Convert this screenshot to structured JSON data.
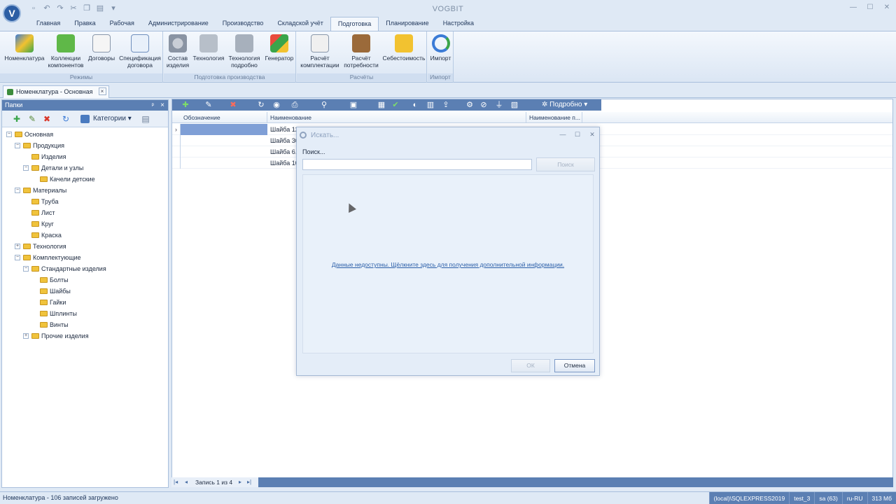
{
  "app": {
    "title": "VOGBIT",
    "logo_letter": "V"
  },
  "quick_access": [
    "new-icon",
    "undo-icon",
    "redo-icon",
    "cut-icon",
    "copy-icon",
    "paste-icon"
  ],
  "ribbon_tabs": [
    {
      "label": "Главная"
    },
    {
      "label": "Правка"
    },
    {
      "label": "Рабочая"
    },
    {
      "label": "Администрирование"
    },
    {
      "label": "Производство"
    },
    {
      "label": "Складской учёт"
    },
    {
      "label": "Подготовка",
      "active": true
    },
    {
      "label": "Планирование"
    },
    {
      "label": "Настройка"
    }
  ],
  "ribbon": {
    "groups": [
      {
        "caption": "Режимы",
        "buttons": [
          {
            "l1": "Номенклатура",
            "l2": "",
            "icon": "nomenclature-icon"
          },
          {
            "l1": "Коллекции",
            "l2": "компонентов",
            "icon": "collections-icon"
          },
          {
            "l1": "Договоры",
            "l2": "",
            "icon": "contracts-icon"
          },
          {
            "l1": "Спецификация",
            "l2": "договора",
            "icon": "contract-spec-icon"
          }
        ]
      },
      {
        "caption": "Подготовка производства",
        "buttons": [
          {
            "l1": "Состав",
            "l2": "изделия",
            "icon": "gear-icon"
          },
          {
            "l1": "Технология",
            "l2": "",
            "icon": "wrench-icon"
          },
          {
            "l1": "Технология",
            "l2": "подробно",
            "icon": "tools-icon"
          },
          {
            "l1": "Генератор",
            "l2": "",
            "icon": "shapes-icon"
          }
        ]
      },
      {
        "caption": "Расчёты",
        "buttons": [
          {
            "l1": "Расчёт",
            "l2": "комплектации",
            "icon": "calculator-icon"
          },
          {
            "l1": "Расчёт",
            "l2": "потребности",
            "icon": "abacus-icon"
          },
          {
            "l1": "Себестоимость",
            "l2": "",
            "icon": "coins-icon"
          }
        ]
      },
      {
        "caption": "Импорт",
        "buttons": [
          {
            "l1": "Импорт",
            "l2": "",
            "icon": "import-icon"
          }
        ]
      }
    ]
  },
  "doc_tab": {
    "label": "Номенклатура - Основная",
    "close": "×"
  },
  "left_panel": {
    "title": "Папки",
    "pin": "ᵖ",
    "close": "×",
    "categories_label": "Категории",
    "tree": [
      {
        "label": "Основная",
        "level": 0,
        "exp": "−"
      },
      {
        "label": "Продукция",
        "level": 1,
        "exp": "−"
      },
      {
        "label": "Изделия",
        "level": 2,
        "exp": ""
      },
      {
        "label": "Детали и узлы",
        "level": 2,
        "exp": "−"
      },
      {
        "label": "Качели детские",
        "level": 3,
        "exp": ""
      },
      {
        "label": "Материалы",
        "level": 1,
        "exp": "−"
      },
      {
        "label": "Труба",
        "level": 2,
        "exp": ""
      },
      {
        "label": "Лист",
        "level": 2,
        "exp": ""
      },
      {
        "label": "Круг",
        "level": 2,
        "exp": ""
      },
      {
        "label": "Краска",
        "level": 2,
        "exp": ""
      },
      {
        "label": "Технология",
        "level": 1,
        "exp": "+"
      },
      {
        "label": "Комплектующие",
        "level": 1,
        "exp": "−"
      },
      {
        "label": "Стандартные изделия",
        "level": 2,
        "exp": "−"
      },
      {
        "label": "Болты",
        "level": 3,
        "exp": ""
      },
      {
        "label": "Шайбы",
        "level": 3,
        "exp": ""
      },
      {
        "label": "Гайки",
        "level": 3,
        "exp": ""
      },
      {
        "label": "Шплинты",
        "level": 3,
        "exp": ""
      },
      {
        "label": "Винты",
        "level": 3,
        "exp": ""
      },
      {
        "label": "Прочие изделия",
        "level": 2,
        "exp": "+"
      }
    ]
  },
  "grid": {
    "detail_label": "Подробно",
    "columns": [
      "Обозначение",
      "Наименование",
      "Наименование п..."
    ],
    "rows": [
      {
        "oboz": "",
        "name": "Шайба 12",
        "selected": true
      },
      {
        "oboz": "",
        "name": "Шайба 30",
        "selected": false
      },
      {
        "oboz": "",
        "name": "Шайба 6.0",
        "selected": false
      },
      {
        "oboz": "",
        "name": "Шайба 10",
        "selected": false
      }
    ],
    "footer_record": "Запись 1 из 4"
  },
  "status": {
    "text": "Номенклатура - 106 записей загружено",
    "server": "(local)\\SQLEXPRESS2019",
    "db": "test_3",
    "user": "sa (63)",
    "locale": "ru-RU",
    "memory": "313 Мб"
  },
  "dialog": {
    "title": "Искать...",
    "search_label": "Поиск...",
    "search_value": "",
    "search_button": "Поиск",
    "info_link": "Данные недоступны. Щёлкните здесь для получения дополнительной информации.",
    "ok": "ОК",
    "cancel": "Отмена"
  },
  "colors": {
    "accent": "#5b7fb3",
    "selected_row": "#7f9fd6",
    "link": "#2a5ea8"
  }
}
